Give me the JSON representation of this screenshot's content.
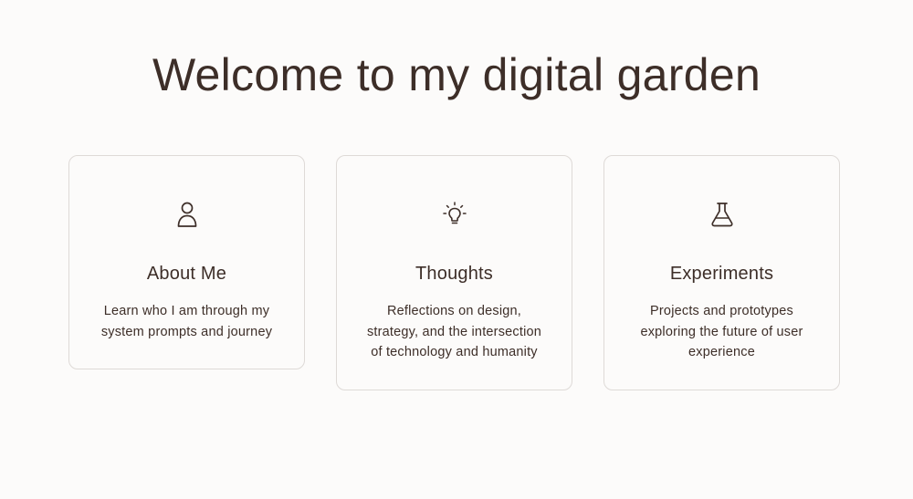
{
  "header": {
    "title": "Welcome to my digital garden"
  },
  "cards": [
    {
      "icon": "user-icon",
      "title": "About Me",
      "description": "Learn who I am through my system prompts and journey"
    },
    {
      "icon": "lightbulb-icon",
      "title": "Thoughts",
      "description": "Reflections on design, strategy, and the intersection of technology and humanity"
    },
    {
      "icon": "flask-icon",
      "title": "Experiments",
      "description": "Projects and prototypes exploring the future of user experience"
    }
  ],
  "colors": {
    "background": "#fcfbfa",
    "text": "#3d2e28",
    "card_border": "#dedad7"
  }
}
